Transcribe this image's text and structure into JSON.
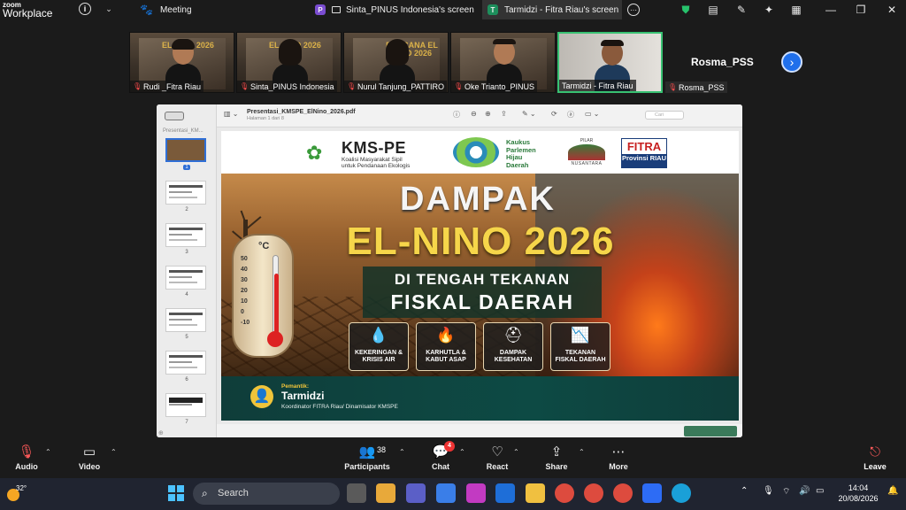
{
  "app": {
    "brand_top": "zoom",
    "brand_bottom": "Workplace"
  },
  "tabs": [
    {
      "label": "Meeting",
      "icon": "paw-icon"
    },
    {
      "label": "Sinta_PINUS Indonesia's screen",
      "badge": "P"
    },
    {
      "label": "Tarmidzi - Fitra Riau's screen",
      "badge": "T"
    }
  ],
  "participants_strip": [
    {
      "name": "Rudi _Fitra Riau",
      "muted": true,
      "poster_text": "EL NINO 2026"
    },
    {
      "name": "Sinta_PINUS Indonesia",
      "muted": true,
      "poster_text": "EL NINO 2026"
    },
    {
      "name": "Nurul Tanjung_PATTIRO",
      "muted": true,
      "poster_text": "BENCANA EL NINO 2026"
    },
    {
      "name": "Oke Trianto_PINUS",
      "muted": true,
      "poster_text": ""
    },
    {
      "name": "Tarmidzi - Fitra Riau",
      "muted": false,
      "speaking": true
    },
    {
      "name": "Rosma_PSS",
      "display_name": "Rosma_PSS",
      "muted": true
    }
  ],
  "viewer": {
    "filename": "Presentasi_KMSPE_ElNino_2026.pdf",
    "page_info": "Halaman 1 dari 8",
    "sidebar_title": "Presentasi_KM...",
    "search_placeholder": "Cari",
    "thumb_numbers": [
      "1",
      "2",
      "3",
      "4",
      "5",
      "6",
      "7"
    ]
  },
  "slide": {
    "kms_title": "KMS-PE",
    "kms_sub1": "Koalisi Masyarakat Sipil",
    "kms_sub2": "untuk Pendanaan Ekologis",
    "kp_line1": "Kaukus",
    "kp_line2": "Parlemen",
    "kp_line3": "Hijau",
    "kp_line4": "Daerah",
    "pilar_top": "PILAR",
    "pilar_bottom": "NUSANTARA",
    "fitra_top": "FITRA",
    "fitra_bottom": "Provinsi RIAU",
    "title1": "DAMPAK",
    "title2": "EL-NINO 2026",
    "subtitle1": "DI TENGAH TEKANAN",
    "subtitle2": "FISKAL DAERAH",
    "thermo_unit": "°C",
    "thermo_scale": [
      "50",
      "40",
      "30",
      "20",
      "10",
      "0",
      "-10"
    ],
    "impacts": [
      {
        "label1": "KEKERINGAN &",
        "label2": "KRISIS AIR",
        "icon": "drought-icon"
      },
      {
        "label1": "KARHUTLA &",
        "label2": "KABUT ASAP",
        "icon": "fire-icon"
      },
      {
        "label1": "DAMPAK",
        "label2": "KESEHATAN",
        "icon": "health-icon"
      },
      {
        "label1": "TEKANAN",
        "label2": "FISKAL DAERAH",
        "icon": "fiscal-icon"
      }
    ],
    "presenter_label": "Pemantik:",
    "presenter_name": "Tarmidzi",
    "presenter_role": "Koordinator FITRA Riau/ Dinamisator KMSPE"
  },
  "toolbar": {
    "audio": "Audio",
    "video": "Video",
    "participants": "Participants",
    "participants_count": "38",
    "chat": "Chat",
    "chat_badge": "4",
    "react": "React",
    "share": "Share",
    "more": "More",
    "leave": "Leave"
  },
  "taskbar": {
    "temperature": "32°",
    "search": "Search",
    "time": "14:04",
    "date": "20/08/2026"
  },
  "colors": {
    "accent_green": "#38c172",
    "next_blue": "#1f6feb",
    "chat_badge": "#e33333",
    "leave_red": "#ff5a5a",
    "slide_title_yellow": "#f6d64a",
    "slide_footer": "#0f3d3a"
  }
}
